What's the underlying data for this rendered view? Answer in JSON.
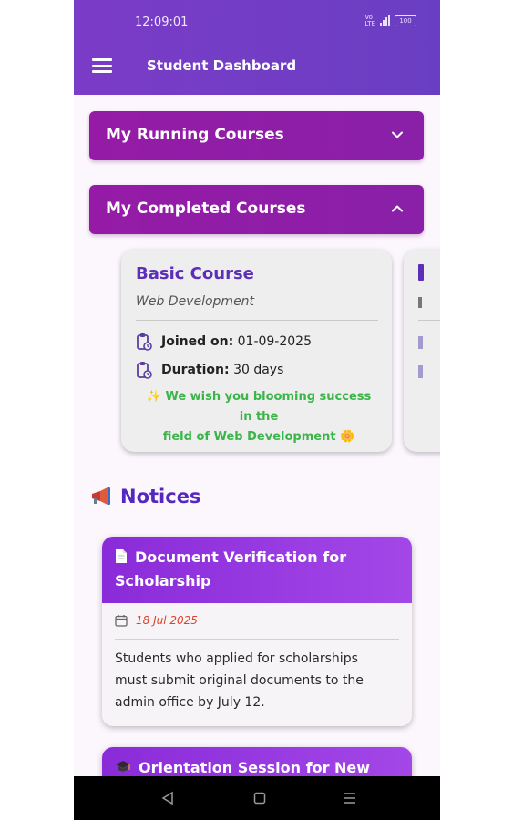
{
  "status_bar": {
    "time": "12:09:01",
    "net_label": "VoLTE",
    "battery": "100"
  },
  "app_bar": {
    "title": "Student Dashboard"
  },
  "accordions": [
    {
      "label": "My Running Courses",
      "expanded": false
    },
    {
      "label": "My Completed Courses",
      "expanded": true
    }
  ],
  "completed_courses": [
    {
      "title": "Basic Course",
      "category": "Web Development",
      "joined_label": "Joined on:",
      "joined_value": "01-09-2025",
      "duration_label": "Duration:",
      "duration_value": "30 days",
      "wish_line1": "✨ We wish you blooming success in the",
      "wish_line2": "field of Web Development 🌼"
    }
  ],
  "notices": {
    "heading": "Notices",
    "items": [
      {
        "title": "Document Verification for Scholarship",
        "date": "18 Jul 2025",
        "body": "Students who applied for scholarships must submit original documents to the admin office by July 12."
      },
      {
        "title": "Orientation Session for New"
      }
    ]
  },
  "colors": {
    "app_bar": "#7b3cc7",
    "accordion": "#951ba6",
    "course_title": "#5c2fb8",
    "wish_text": "#3bb54a",
    "notice_header": "#8a2bd9",
    "notice_date": "#d9452f"
  }
}
